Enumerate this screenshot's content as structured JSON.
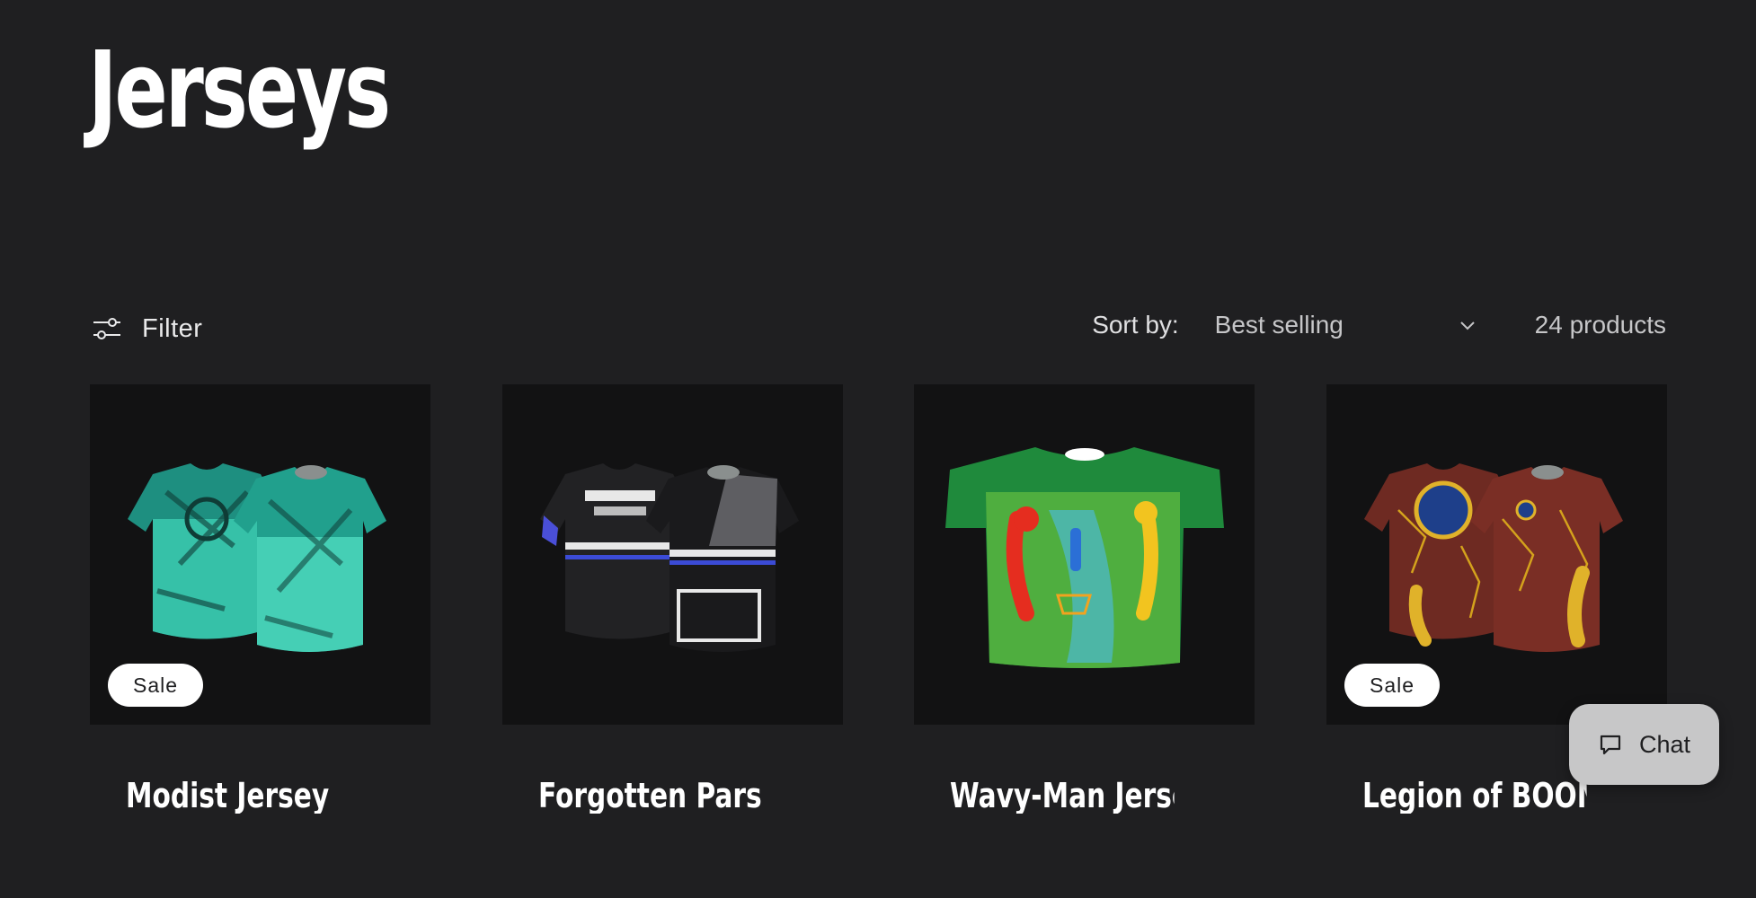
{
  "page": {
    "title": "Jerseys"
  },
  "toolbar": {
    "filter_label": "Filter",
    "sort_label": "Sort by:",
    "sort_value": "Best selling",
    "product_count": "24 products"
  },
  "products": [
    {
      "title": "Modist Jersey",
      "badge": "Sale",
      "image": "teal-geometric-jersey"
    },
    {
      "title": "Forgotten Pars",
      "badge": "",
      "image": "black-forgotten-pars-jersey"
    },
    {
      "title": "Wavy-Man Jersey",
      "badge": "",
      "image": "green-wavy-man-jersey"
    },
    {
      "title": "Legion of BOOM",
      "badge": "Sale",
      "image": "maroon-legion-of-boom-jersey"
    }
  ],
  "chat": {
    "label": "Chat",
    "icon": "chat-bubble-icon"
  },
  "icons": {
    "filter": "sliders-icon",
    "sort": "chevron-down-icon"
  },
  "colors": {
    "background": "#1f1f21",
    "badge_bg": "#ffffff",
    "chat_bg": "#c7c7c8"
  }
}
